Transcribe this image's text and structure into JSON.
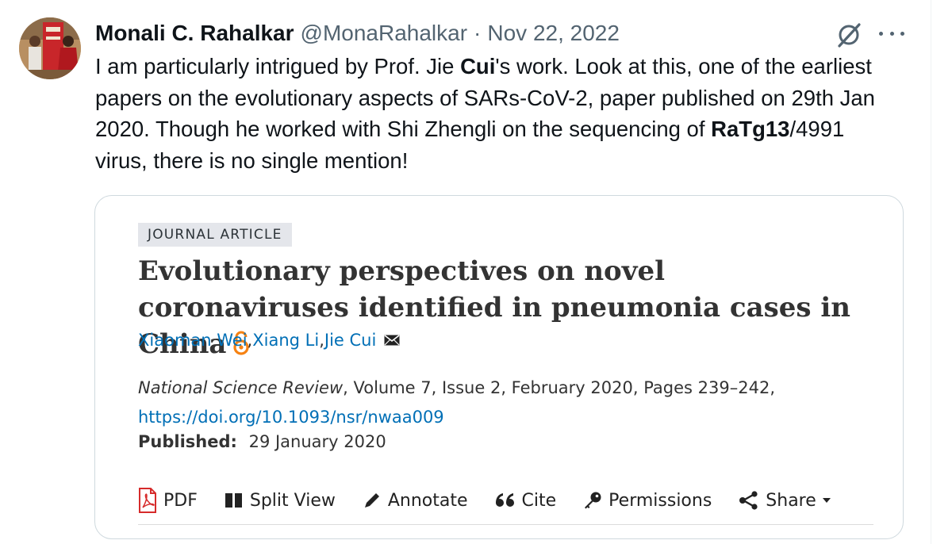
{
  "tweet": {
    "author": "Monali C. Rahalkar",
    "handle": "@MonaRahalkar",
    "separator": "·",
    "date": "Nov 22, 2022",
    "text_parts": [
      "I am particularly intrigued by Prof. Jie ",
      "Cui",
      "'s work. Look at this, one of the earliest papers on the evolutionary aspects of SARs-CoV-2, paper published on 29th Jan 2020. Though he worked with Shi Zhengli on the sequencing of ",
      "RaTg13",
      "/4991 virus, there is no single mention!"
    ]
  },
  "card": {
    "tag": "JOURNAL ARTICLE",
    "title": "Evolutionary perspectives on novel coronaviruses identified in pneumonia cases in China",
    "authors": [
      "Xiaoman Wei",
      "Xiang Li",
      "Jie Cui"
    ],
    "author_separator": ", ",
    "journal": "National Science Review",
    "citation_rest": ", Volume 7, Issue 2, February 2020, Pages 239–242, ",
    "doi": "https://doi.org/10.1093/nsr/nwaa009",
    "published_label": "Published:",
    "published_date": "29 January 2020",
    "toolbar": {
      "pdf": "PDF",
      "split_view": "Split View",
      "annotate": "Annotate",
      "cite": "Cite",
      "permissions": "Permissions",
      "share": "Share"
    }
  },
  "icons": {
    "grok": "grok-icon",
    "more": "more-icon",
    "open_access": "open-access-icon",
    "mail": "mail-icon",
    "pdf": "pdf-icon",
    "split_view": "split-view-icon",
    "annotate": "pencil-icon",
    "cite": "quote-icon",
    "permissions": "key-icon",
    "share": "share-icon",
    "share_dropdown": "caret-down-icon"
  },
  "colors": {
    "link": "#006fb6",
    "open_access": "#f68212",
    "pdf": "#d62b2b",
    "secondary_text": "#536471"
  }
}
